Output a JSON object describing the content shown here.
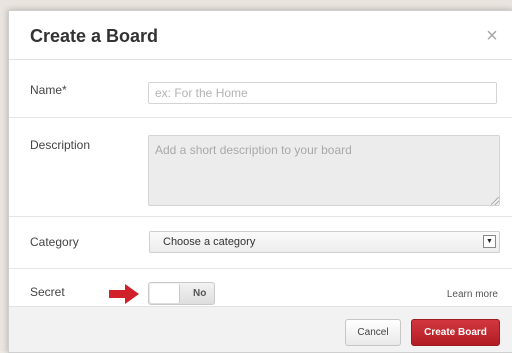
{
  "dialog": {
    "title": "Create a Board",
    "close_icon": "close-icon"
  },
  "form": {
    "name": {
      "label": "Name*",
      "value": "",
      "placeholder": "ex: For the Home"
    },
    "description": {
      "label": "Description",
      "value": "",
      "placeholder": "Add a short description to your board"
    },
    "category": {
      "label": "Category",
      "selected": "Choose a category"
    },
    "secret": {
      "label": "Secret",
      "toggle_text": "No",
      "learn_more": "Learn more",
      "arrow_icon": "red-arrow-right-icon",
      "arrow_color": "#d0202a"
    }
  },
  "footer": {
    "cancel_label": "Cancel",
    "create_label": "Create Board",
    "create_color": "#c3262e"
  }
}
